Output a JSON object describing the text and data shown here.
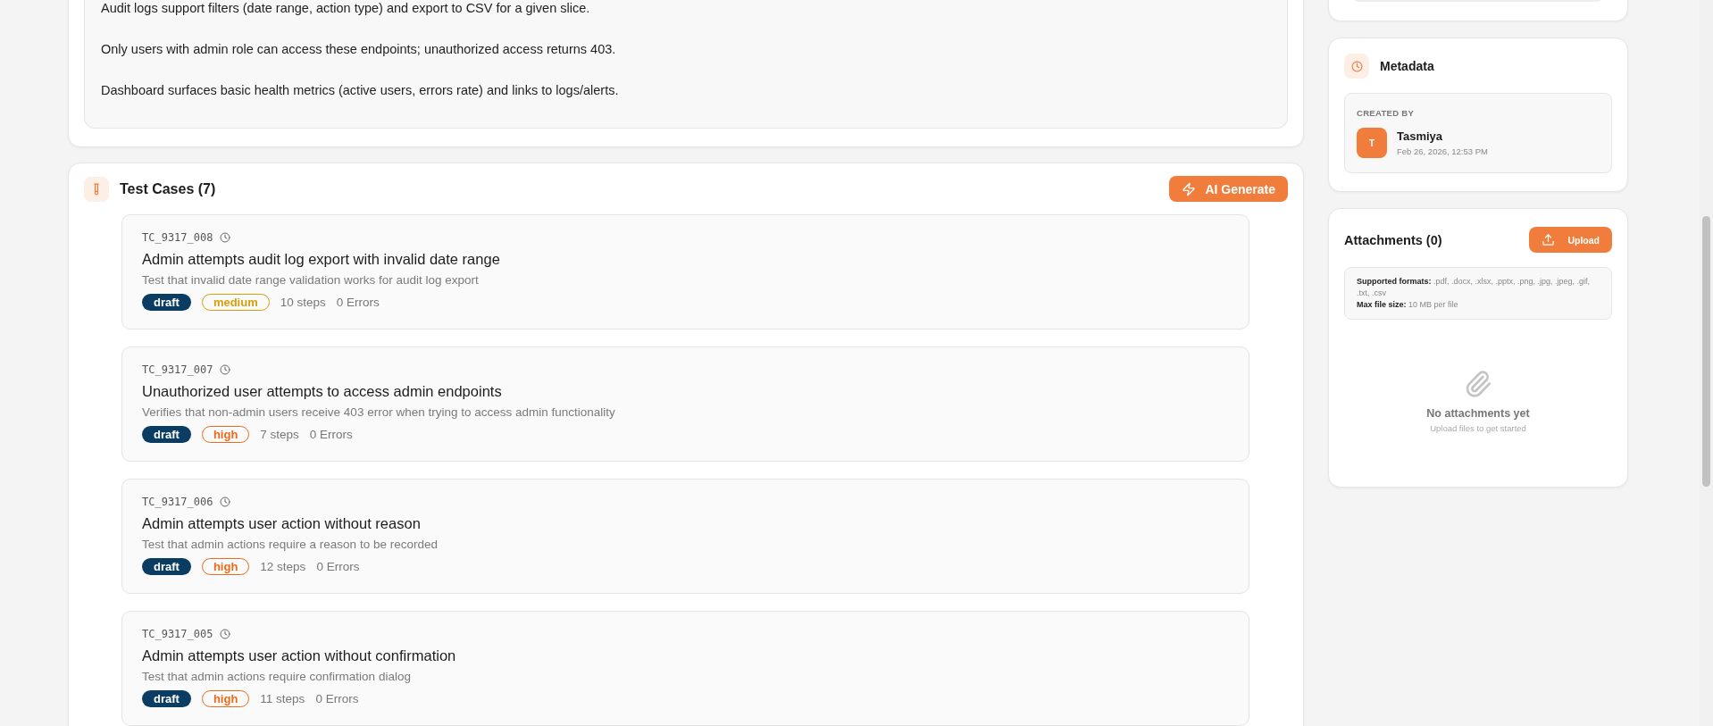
{
  "requirements": {
    "paragraphs": [
      "Audit logs support filters (date range, action type) and export to CSV for a given slice.",
      "Only users with admin role can access these endpoints; unauthorized access returns 403.",
      "Dashboard surfaces basic health metrics (active users, errors rate) and links to logs/alerts."
    ]
  },
  "test_cases": {
    "title": "Test Cases (7)",
    "generate_button": "AI Generate",
    "items": [
      {
        "id": "TC_9317_008",
        "title": "Admin attempts audit log export with invalid date range",
        "description": "Test that invalid date range validation works for audit log export",
        "status": {
          "label": "draft",
          "color": "#0b3d63"
        },
        "priority": {
          "label": "medium",
          "color": "#d69e0b"
        },
        "steps": "10 steps",
        "errors": "0 Errors"
      },
      {
        "id": "TC_9317_007",
        "title": "Unauthorized user attempts to access admin endpoints",
        "description": "Verifies that non-admin users receive 403 error when trying to access admin functionality",
        "status": {
          "label": "draft",
          "color": "#0b3d63"
        },
        "priority": {
          "label": "high",
          "color": "#ec6a1c"
        },
        "steps": "7 steps",
        "errors": "0 Errors"
      },
      {
        "id": "TC_9317_006",
        "title": "Admin attempts user action without reason",
        "description": "Test that admin actions require a reason to be recorded",
        "status": {
          "label": "draft",
          "color": "#0b3d63"
        },
        "priority": {
          "label": "high",
          "color": "#ec6a1c"
        },
        "steps": "12 steps",
        "errors": "0 Errors"
      },
      {
        "id": "TC_9317_005",
        "title": "Admin attempts user action without confirmation",
        "description": "Test that admin actions require confirmation dialog",
        "status": {
          "label": "draft",
          "color": "#0b3d63"
        },
        "priority": {
          "label": "high",
          "color": "#ec6a1c"
        },
        "steps": "11 steps",
        "errors": "0 Errors"
      }
    ]
  },
  "metadata": {
    "title": "Metadata",
    "created_label": "CREATED BY",
    "avatar_initial": "T",
    "user": "Tasmiya",
    "created_at": "Feb 26, 2026, 12:53 PM"
  },
  "attachments": {
    "title": "Attachments (0)",
    "upload_button": "Upload",
    "formats_info": "**Supported formats:** .pdf, .docx, .xlsx, .pptx, .png, .jpg, .jpeg, .gif, .txt, .csv",
    "size_info": "**Max file size:** 10 MB per file",
    "empty_title": "No attachments yet",
    "empty_hint": "Upload files to get started"
  }
}
